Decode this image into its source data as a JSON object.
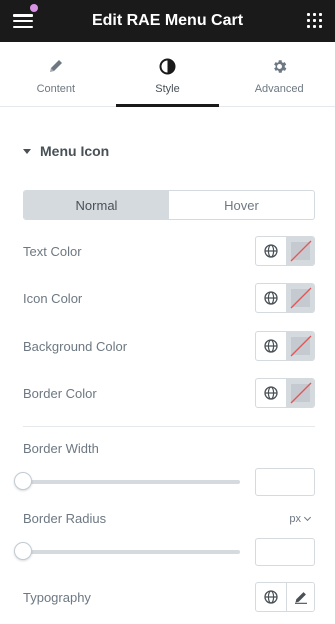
{
  "header": {
    "title": "Edit RAE Menu Cart"
  },
  "tabs": [
    {
      "label": "Content",
      "icon": "pencil-icon"
    },
    {
      "label": "Style",
      "icon": "half-circle-icon",
      "active": true
    },
    {
      "label": "Advanced",
      "icon": "gear-icon"
    }
  ],
  "section": {
    "title": "Menu Icon"
  },
  "state_toggle": {
    "normal": "Normal",
    "hover": "Hover",
    "active": "Normal"
  },
  "colors": {
    "text_color": "Text Color",
    "icon_color": "Icon Color",
    "background_color": "Background Color",
    "border_color": "Border Color"
  },
  "border_width": {
    "label": "Border Width",
    "value": "",
    "slider_fraction": 0
  },
  "border_radius": {
    "label": "Border Radius",
    "unit": "px",
    "value": "",
    "slider_fraction": 0
  },
  "typography": {
    "label": "Typography"
  },
  "palette": {
    "topbar": "#1a1a1a",
    "notification_dot": "#d892e4",
    "swatch_empty_line": "#e25656"
  }
}
